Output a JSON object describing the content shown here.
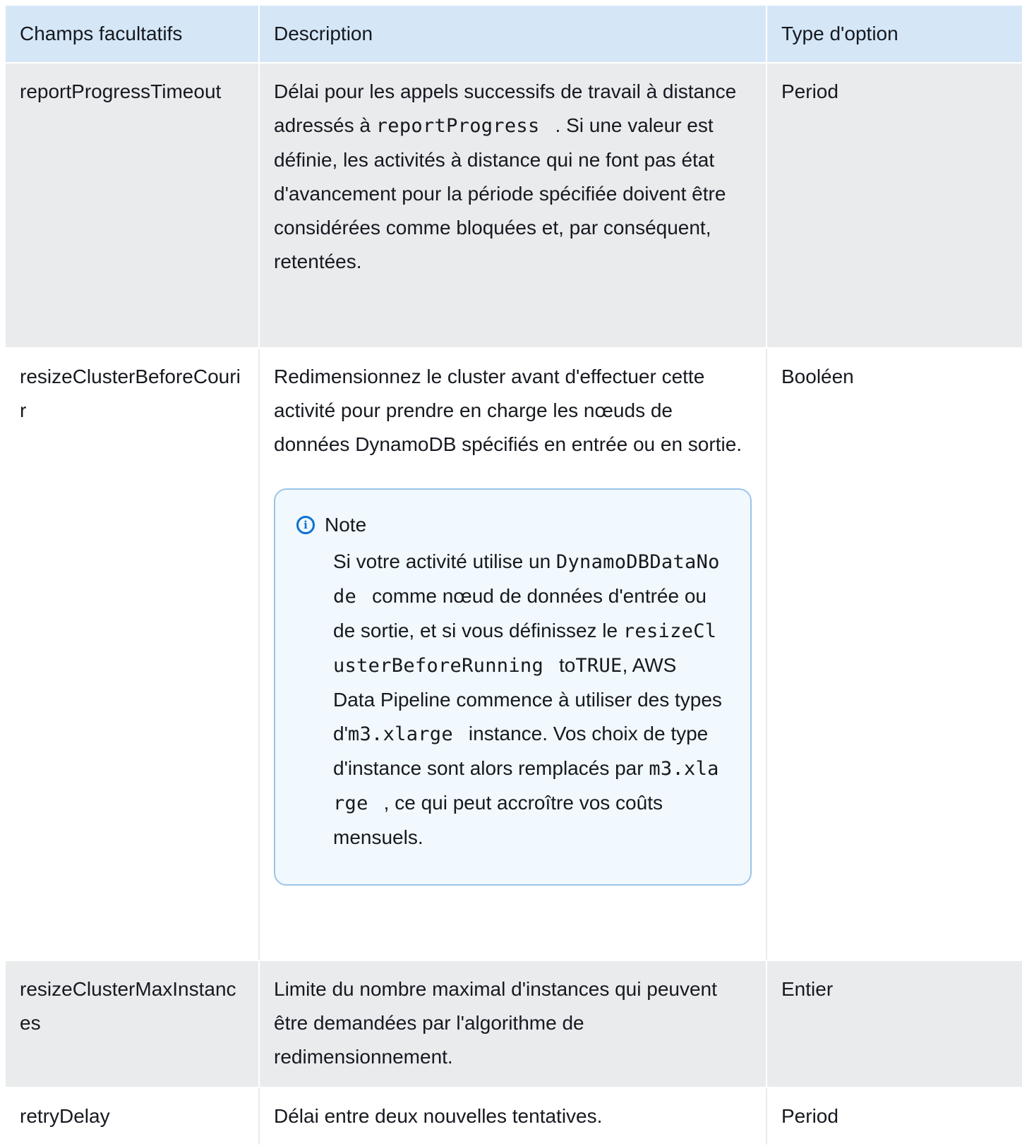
{
  "headers": {
    "field": "Champs facultatifs",
    "description": "Description",
    "type": "Type d'option"
  },
  "rows": [
    {
      "field": "reportProgressTimeout",
      "desc_before": "Délai pour les appels successifs de travail à distance adressés à ",
      "desc_code": "reportProgress",
      "desc_after": ". Si une valeur est définie, les activités à distance qui ne font pas état d'avancement pour la période spécifiée doivent être considérées comme bloquées et, par conséquent, retentées.",
      "type": "Period"
    },
    {
      "field": "resizeClusterBeforeCourir",
      "desc_text": "Redimensionnez le cluster avant d'effectuer cette activité pour prendre en charge les nœuds de données DynamoDB spécifiés en entrée ou en sortie.",
      "type": "Booléen",
      "note": {
        "title": "Note",
        "t1": "Si votre activité utilise un ",
        "c1": "DynamoDBDataNode",
        "t2": "comme nœud de données d'entrée ou de sortie, et si vous définissez le ",
        "c2": "resizeClusterBeforeRunning",
        "t3": "to",
        "c3": "TRUE",
        "t4": ", AWS Data Pipeline commence à utiliser des types d'",
        "c4": "m3.xlarge",
        "t5": "instance. Vos choix de type d'instance sont alors remplacés par ",
        "c5": "m3.xlarge",
        "t6": ", ce qui peut accroître vos coûts mensuels."
      }
    },
    {
      "field": "resizeClusterMaxInstances",
      "desc_text": "Limite du nombre maximal d'instances qui peuvent être demandées par l'algorithme de redimensionnement.",
      "type": "Entier"
    },
    {
      "field": "retryDelay",
      "desc_text": "Délai entre deux nouvelles tentatives.",
      "type": "Period"
    }
  ],
  "colors": {
    "header_bg": "#d5e7f7",
    "row_gray": "#e9ebed",
    "note_border": "#9bc4e8",
    "note_bg": "#f1f8fe",
    "info_blue": "#0972d3"
  },
  "icons": {
    "note_icon": "info-circle-icon"
  }
}
